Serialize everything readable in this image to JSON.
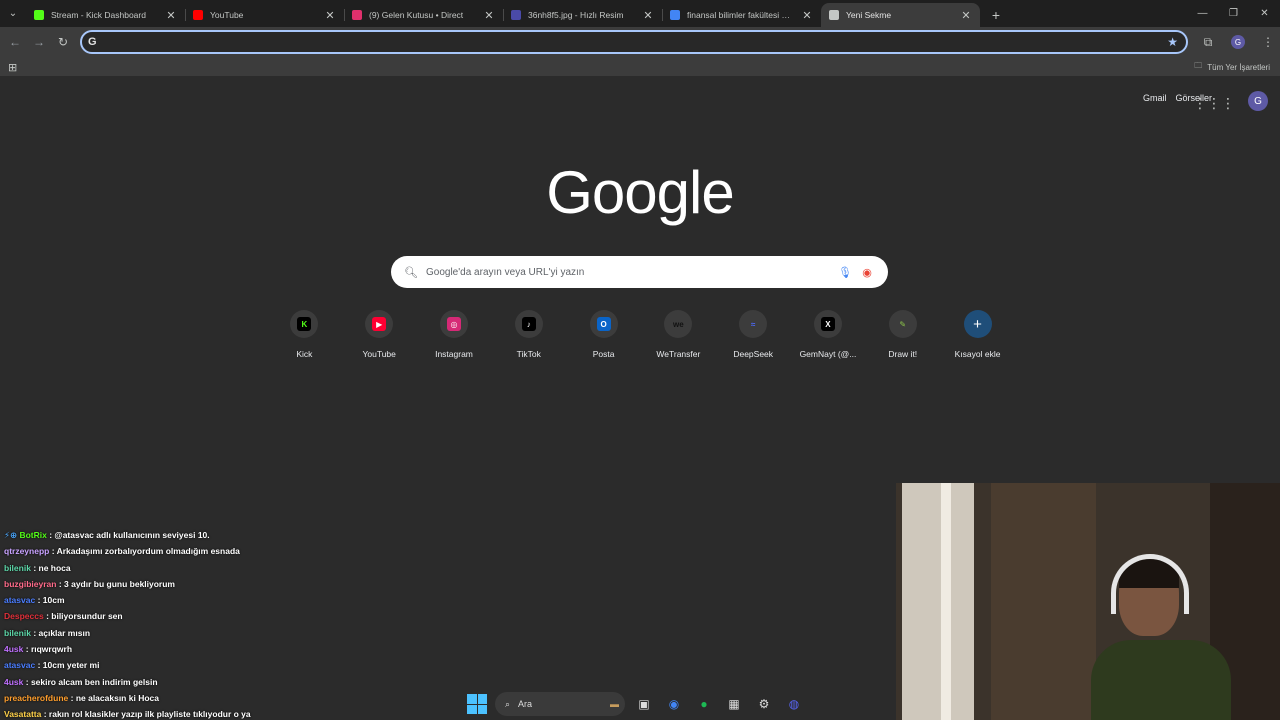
{
  "tabs": [
    {
      "title": "Stream - Kick Dashboard",
      "favicon": "kick-icon",
      "color": "#53fc18"
    },
    {
      "title": "YouTube",
      "favicon": "youtube-icon",
      "color": "#ff0000"
    },
    {
      "title": "(9) Gelen Kutusu • Direct",
      "favicon": "instagram-icon",
      "color": "#e1306c"
    },
    {
      "title": "36nh8f5.jpg - Hızlı Resim",
      "favicon": "hizliresim-icon",
      "color": "#4a4aa8"
    },
    {
      "title": "finansal bilimler fakültesi hbv -",
      "favicon": "google-icon",
      "color": "#4285f4"
    },
    {
      "title": "Yeni Sekme",
      "favicon": "chrome-icon",
      "color": "#c4c7c5",
      "active": true
    }
  ],
  "toolbar": {
    "omnibox_value": "",
    "omnibox_prefix": "G"
  },
  "bookmarks": {
    "all_bookmarks_label": "Tüm Yer İşaretleri"
  },
  "ntp": {
    "gmail": "Gmail",
    "images": "Görseller",
    "avatar_letter": "G",
    "logo": "Google",
    "search_placeholder": "Google'da arayın veya URL'yi yazın",
    "shortcuts": [
      {
        "label": "Kick",
        "glyph": "K",
        "color": "#53fc18",
        "bg": "#000000"
      },
      {
        "label": "YouTube",
        "glyph": "▶",
        "color": "#ffffff",
        "bg": "#ff0033"
      },
      {
        "label": "Instagram",
        "glyph": "◎",
        "color": "#ffffff",
        "bg": "#d62976"
      },
      {
        "label": "TikTok",
        "glyph": "♪",
        "color": "#ffffff",
        "bg": "#000000"
      },
      {
        "label": "Posta",
        "glyph": "O",
        "color": "#ffffff",
        "bg": "#0a64c8"
      },
      {
        "label": "WeTransfer",
        "glyph": "we",
        "color": "#111111",
        "bg": "#3c3c3c"
      },
      {
        "label": "DeepSeek",
        "glyph": "≈",
        "color": "#4d6bfe",
        "bg": "#3c3c3c"
      },
      {
        "label": "GemNayt (@...",
        "glyph": "X",
        "color": "#ffffff",
        "bg": "#000000"
      },
      {
        "label": "Draw it!",
        "glyph": "✎",
        "color": "#8bc34a",
        "bg": "#3c3c3c"
      }
    ],
    "add_shortcut_label": "Kısayol ekle"
  },
  "chat": [
    {
      "user": "BotRix",
      "color": "#53fc18",
      "message": ": @atasvac adlı kullanıcının seviyesi 10.",
      "badge": true
    },
    {
      "user": "qtrzeynepp",
      "color": "#c8a2ff",
      "message": ": Arkadaşımı zorbalıyordum olmadığım esnada"
    },
    {
      "user": "bilenik",
      "color": "#5cd6a8",
      "message": ": ne hoca"
    },
    {
      "user": "buzgibieyran",
      "color": "#ff6b8a",
      "message": ": 3 aydır bu gunu bekliyorum"
    },
    {
      "user": "atasvac",
      "color": "#4a7dff",
      "message": ": 10cm"
    },
    {
      "user": "Despeccs",
      "color": "#e0303a",
      "message": ": biliyorsundur sen"
    },
    {
      "user": "bilenik",
      "color": "#5cd6a8",
      "message": ": açıklar mısın"
    },
    {
      "user": "4usk",
      "color": "#c070ff",
      "message": ": rıqwrqwrh"
    },
    {
      "user": "atasvac",
      "color": "#4a7dff",
      "message": ": 10cm yeter mi"
    },
    {
      "user": "4usk",
      "color": "#c070ff",
      "message": ": sekiro alcam ben indirim gelsin"
    },
    {
      "user": "preacherofdune",
      "color": "#ff9e2c",
      "message": ": ne alacaksın ki Hoca"
    },
    {
      "user": "Vasatatta",
      "color": "#ffd24a",
      "message": ": rakın rol klasikler yazıp ilk playliste tıklıyodur o ya"
    }
  ],
  "taskbar": {
    "search_label": "Ara"
  }
}
